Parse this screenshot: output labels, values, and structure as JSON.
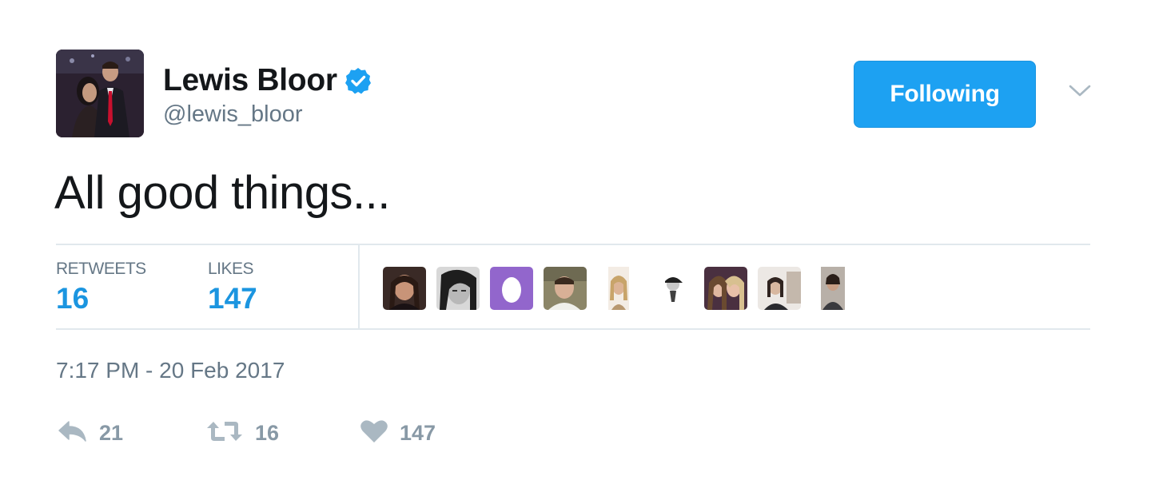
{
  "author": {
    "display_name": "Lewis Bloor",
    "handle": "@lewis_bloor",
    "verified": true
  },
  "follow_button": {
    "label": "Following"
  },
  "tweet": {
    "text": "All good things...",
    "timestamp": "7:17 PM - 20 Feb 2017"
  },
  "stats": {
    "retweets_label": "RETWEETS",
    "retweets_count": "16",
    "likes_label": "LIKES",
    "likes_count": "147"
  },
  "actions": {
    "reply_count": "21",
    "retweet_count": "16",
    "like_count": "147"
  },
  "likers": [
    {
      "name": "liker-avatar-1"
    },
    {
      "name": "liker-avatar-2"
    },
    {
      "name": "liker-avatar-3-default-egg"
    },
    {
      "name": "liker-avatar-4"
    },
    {
      "name": "liker-avatar-5"
    },
    {
      "name": "liker-avatar-6"
    },
    {
      "name": "liker-avatar-7"
    },
    {
      "name": "liker-avatar-8"
    },
    {
      "name": "liker-avatar-9"
    }
  ],
  "colors": {
    "accent": "#1da1f2",
    "stat_value": "#1b95e0",
    "muted_text": "#657786",
    "action_icon": "#aab8c2",
    "divider": "#e1e8ed",
    "default_egg_bg": "#9266cc"
  }
}
